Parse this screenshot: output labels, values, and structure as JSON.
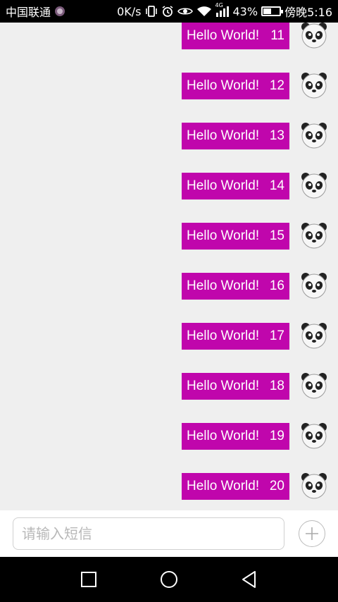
{
  "status_bar": {
    "carrier": "中国联通",
    "speed": "0K/s",
    "network": "4G",
    "battery_percent": "43%",
    "time": "傍晚5:16",
    "icons": [
      "vibrate-icon",
      "alarm-icon",
      "eye-icon",
      "wifi-icon",
      "signal-icon",
      "battery-icon"
    ]
  },
  "messages": [
    {
      "text": "Hello World!",
      "number": "11"
    },
    {
      "text": "Hello World!",
      "number": "12"
    },
    {
      "text": "Hello World!",
      "number": "13"
    },
    {
      "text": "Hello World!",
      "number": "14"
    },
    {
      "text": "Hello World!",
      "number": "15"
    },
    {
      "text": "Hello World!",
      "number": "16"
    },
    {
      "text": "Hello World!",
      "number": "17"
    },
    {
      "text": "Hello World!",
      "number": "18"
    },
    {
      "text": "Hello World!",
      "number": "19"
    },
    {
      "text": "Hello World!",
      "number": "20"
    }
  ],
  "input": {
    "placeholder": "请输入短信",
    "value": ""
  },
  "colors": {
    "bubble": "#c006ac",
    "background": "#efefef"
  },
  "nav": {
    "buttons": [
      "recent-apps-icon",
      "home-icon",
      "back-icon"
    ]
  }
}
